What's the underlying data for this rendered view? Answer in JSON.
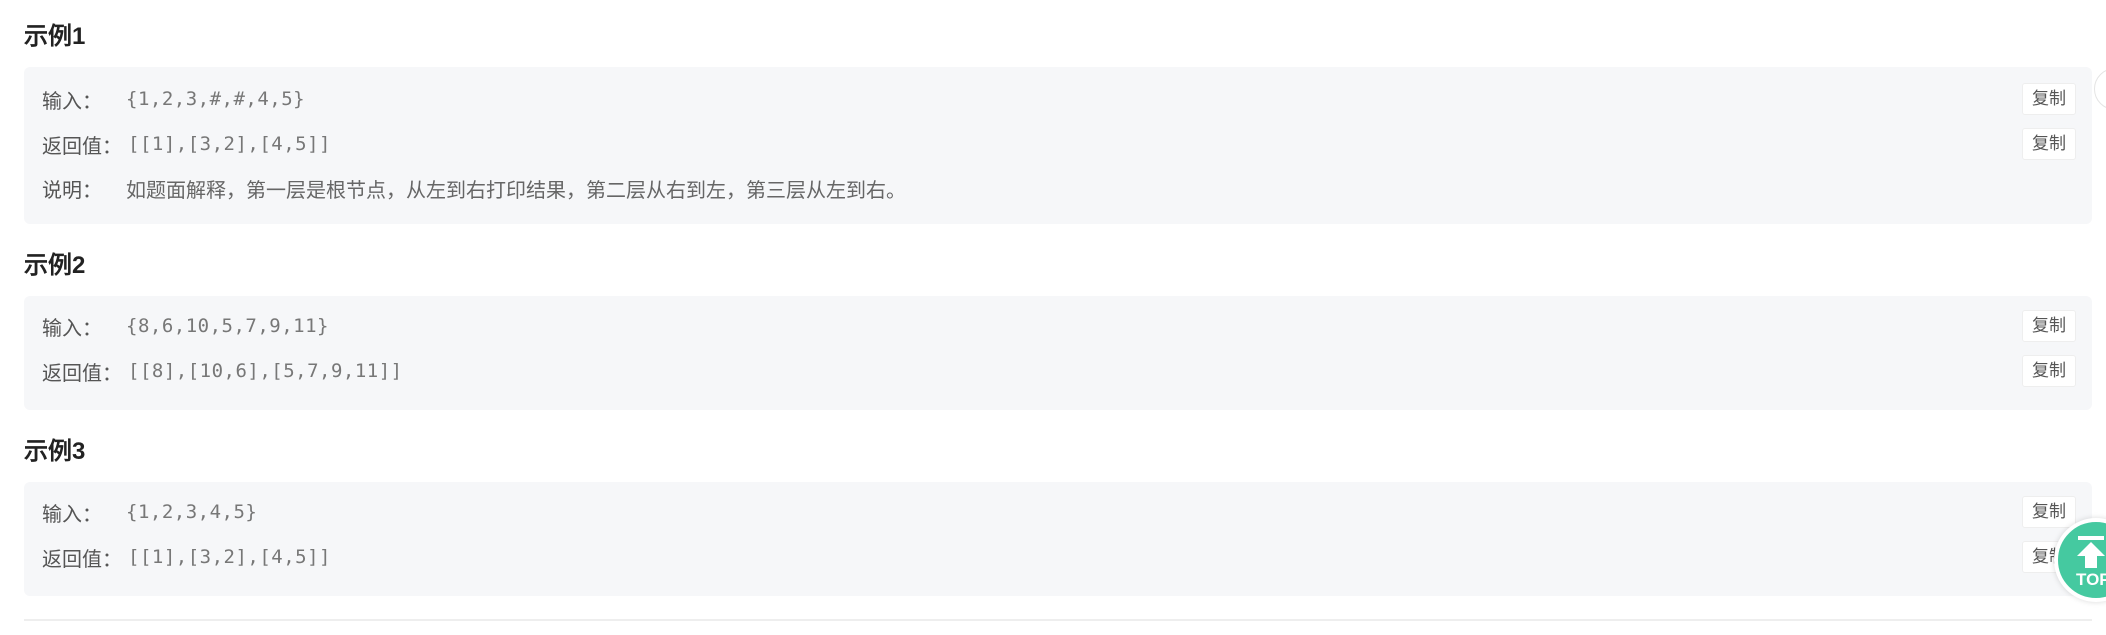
{
  "examples": [
    {
      "title": "示例1",
      "rows": [
        {
          "label": "输入：",
          "value": "{1,2,3,#,#,4,5}",
          "copy": "复制"
        },
        {
          "label": "返回值：",
          "value": "[[1],[3,2],[4,5]]",
          "copy": "复制"
        },
        {
          "label": "说明：",
          "value": "如题面解释，第一层是根节点，从左到右打印结果，第二层从右到左，第三层从左到右。"
        }
      ]
    },
    {
      "title": "示例2",
      "rows": [
        {
          "label": "输入：",
          "value": "{8,6,10,5,7,9,11}",
          "copy": "复制"
        },
        {
          "label": "返回值：",
          "value": "[[8],[10,6],[5,7,9,11]]",
          "copy": "复制"
        }
      ]
    },
    {
      "title": "示例3",
      "rows": [
        {
          "label": "输入：",
          "value": "{1,2,3,4,5}",
          "copy": "复制"
        },
        {
          "label": "返回值：",
          "value": "[[1],[3,2],[4,5]]",
          "copy": "复制"
        }
      ]
    }
  ],
  "back_to_top": {
    "label": "TOP",
    "icon": "arrow-up-to-top-icon",
    "color": "#45c9a0"
  }
}
